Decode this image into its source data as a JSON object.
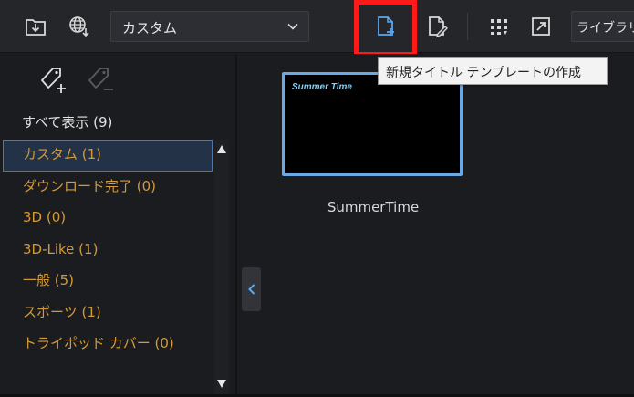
{
  "toolbar": {
    "import_icon": "import-folder-icon",
    "web_icon": "globe-download-icon",
    "category_dropdown": {
      "selected": "カスタム"
    },
    "new_title_template_icon": "new-document-icon",
    "edit_template_icon": "edit-document-icon",
    "view_mode_icon": "grid-view-icon",
    "resize_icon": "resize-icon",
    "library_dropdown": {
      "selected": "ライブラリ"
    }
  },
  "tooltip": {
    "text": "新規タイトル テンプレートの作成"
  },
  "sidebar": {
    "all_tags_label": "すべて表示 (9)",
    "categories": [
      {
        "label": "カスタム (1)",
        "selected": true
      },
      {
        "label": "ダウンロード完了 (0)",
        "selected": false
      },
      {
        "label": "3D (0)",
        "selected": false
      },
      {
        "label": "3D-Like (1)",
        "selected": false
      },
      {
        "label": "一般 (5)",
        "selected": false
      },
      {
        "label": "スポーツ (1)",
        "selected": false
      },
      {
        "label": "トライポッド カバー (0)",
        "selected": false
      }
    ]
  },
  "library": {
    "items": [
      {
        "thumbnail_text": "Summer Time",
        "caption": "SummerTime"
      }
    ]
  },
  "colors": {
    "highlight": "#ff1a1a",
    "selection_border": "#6aa9e6",
    "category_text": "#d49a3a",
    "background": "#1b1c1f"
  }
}
